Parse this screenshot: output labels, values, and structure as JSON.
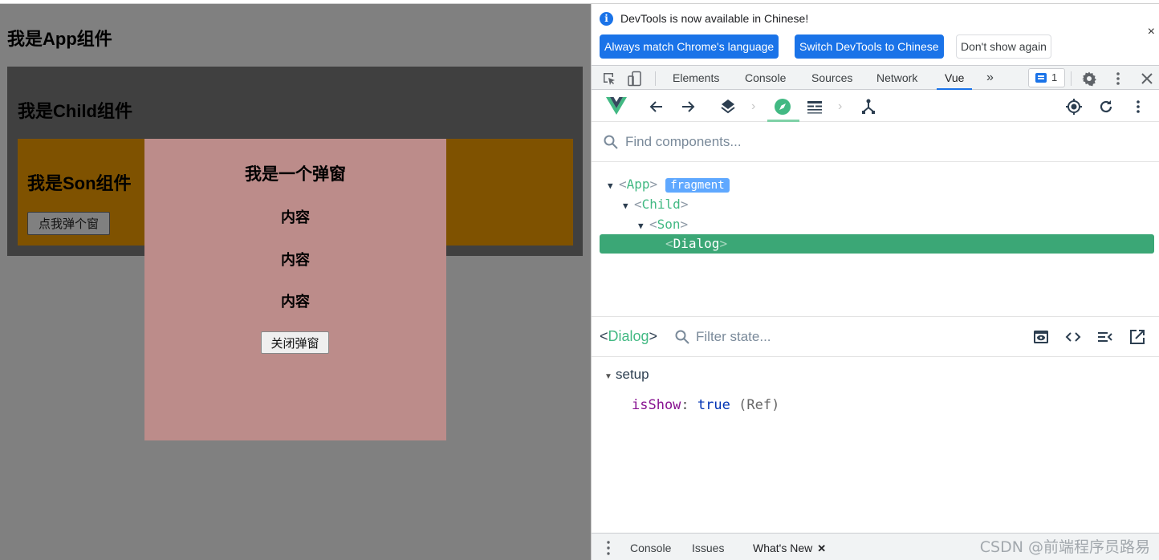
{
  "page": {
    "app_title": "我是App组件",
    "child_title": "我是Child组件",
    "son_title": "我是Son组件",
    "son_button": "点我弹个窗",
    "dialog": {
      "title": "我是一个弹窗",
      "lines": [
        "内容",
        "内容",
        "内容"
      ],
      "close_button": "关闭弹窗"
    },
    "colors": {
      "app_bg": "#808080",
      "child_bg": "#404040",
      "son_bg": "#7f5200",
      "dialog_bg": "#bc8c8a"
    }
  },
  "devtools": {
    "infobar": {
      "message": "DevTools is now available in Chinese!",
      "buttons": [
        "Always match Chrome's language",
        "Switch DevTools to Chinese",
        "Don't show again"
      ],
      "close": "×"
    },
    "tabs": [
      "Elements",
      "Console",
      "Sources",
      "Network",
      "Vue"
    ],
    "active_tab": "Vue",
    "more_tabs": "»",
    "issues_count": "1",
    "vue": {
      "toolbar_icons": [
        "vue-logo-icon",
        "back-arrow-icon",
        "forward-arrow-icon",
        "layers-icon",
        "compass-icon",
        "timeline-icon",
        "routes-icon",
        "target-icon",
        "refresh-icon",
        "more-icon"
      ],
      "search_placeholder": "Find components...",
      "tree": [
        {
          "name": "App",
          "depth": 0,
          "expanded": true,
          "badge": "fragment"
        },
        {
          "name": "Child",
          "depth": 1,
          "expanded": true
        },
        {
          "name": "Son",
          "depth": 2,
          "expanded": true
        },
        {
          "name": "Dialog",
          "depth": 3,
          "selected": true
        }
      ],
      "inspector": {
        "component": "Dialog",
        "filter_placeholder": "Filter state...",
        "section": "setup",
        "props": [
          {
            "key": "isShow",
            "value": "true",
            "meta": "(Ref)"
          }
        ]
      },
      "accent": "#42b983",
      "selected_bg": "#3ba776"
    },
    "drawer": {
      "tabs": [
        "Console",
        "Issues",
        "What's New"
      ],
      "active_tab": "What's New",
      "close_tab": "✕"
    },
    "watermark": "CSDN @前端程序员路易"
  },
  "symbols": {
    "lt": "<",
    "gt": ">",
    "colon": ":",
    "tri_down": "▼",
    "chev": "›"
  }
}
